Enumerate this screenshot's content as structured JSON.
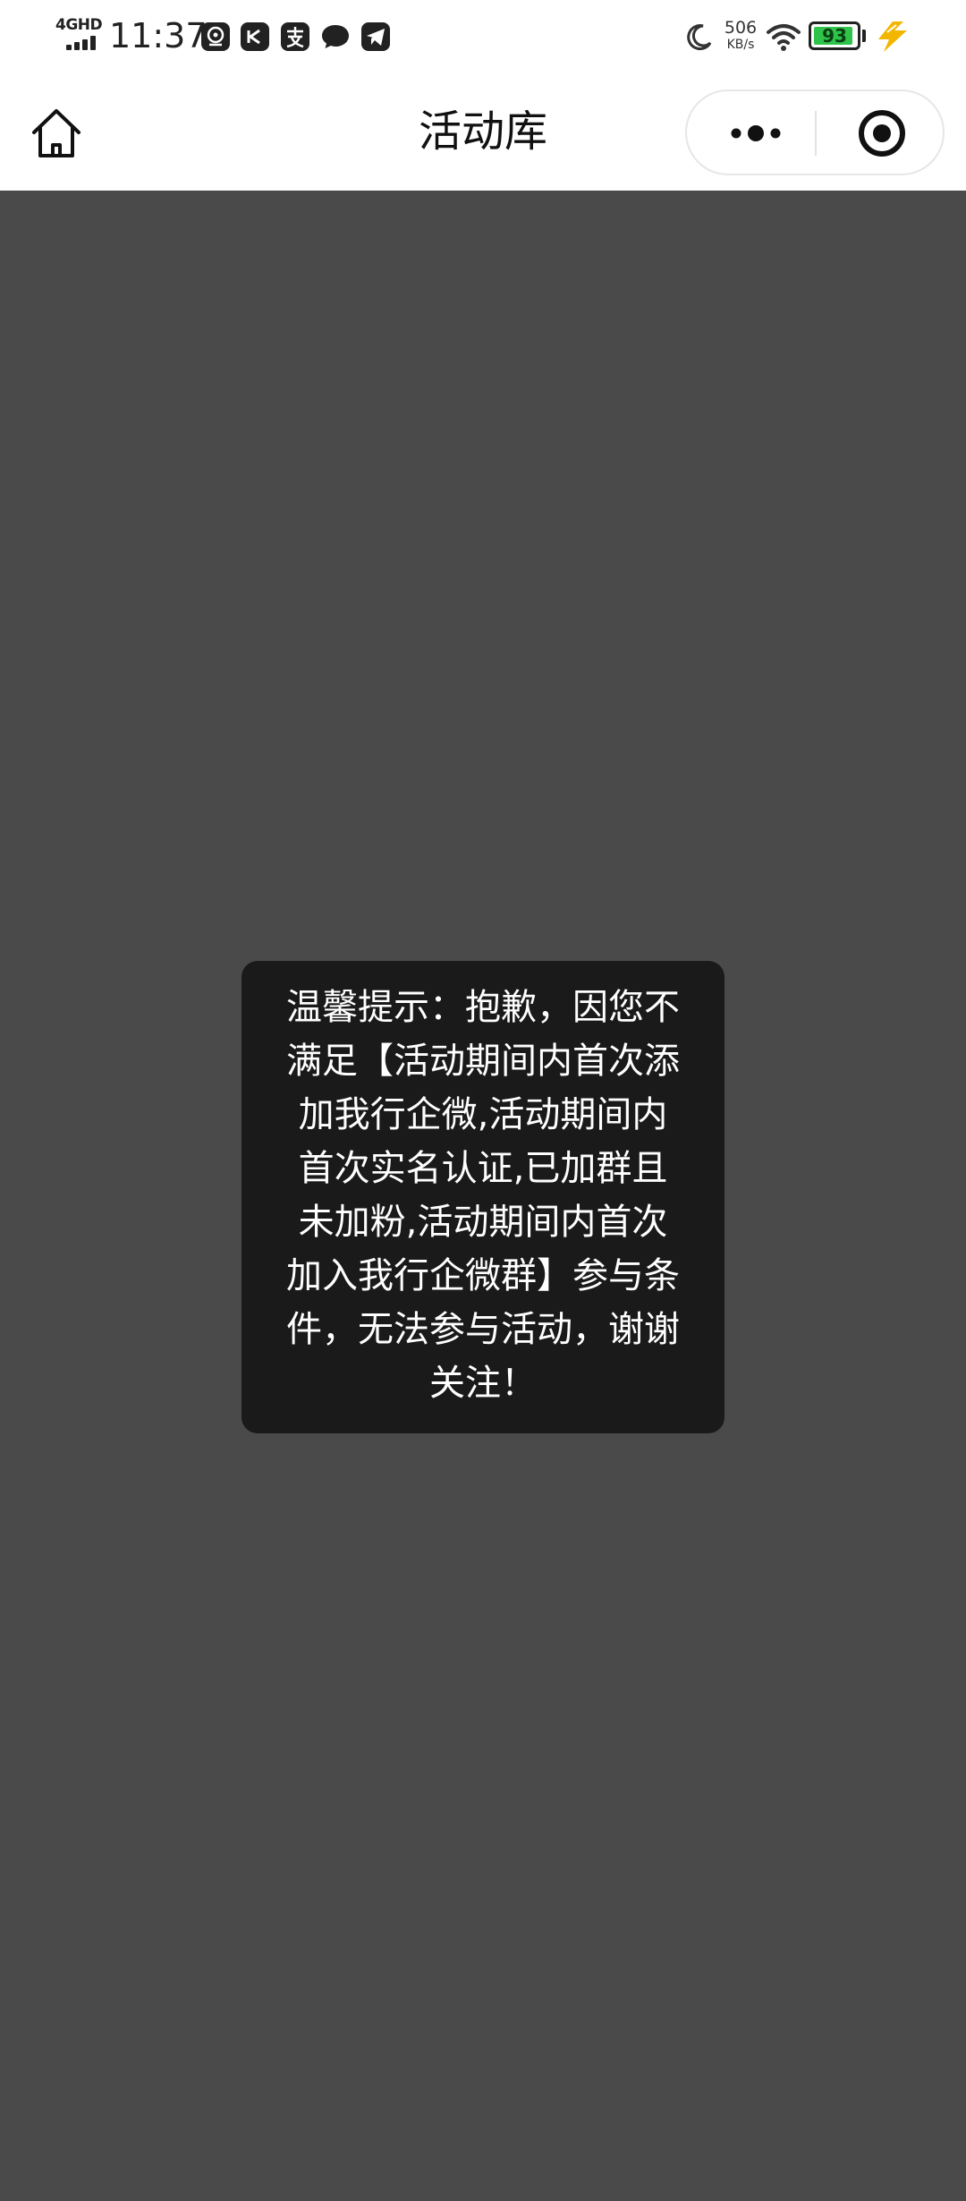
{
  "status_bar": {
    "network_type": "4GHD",
    "time": "11:37",
    "notification_icons": [
      "baidu-map-icon",
      "capcut-icon",
      "alipay-icon",
      "message-icon",
      "telegram-icon"
    ],
    "dnd_icon": "moon-icon",
    "net_speed_value": "506",
    "net_speed_unit": "KB/s",
    "wifi_icon": "wifi-icon",
    "battery_level": "93",
    "battery_fraction": 0.93,
    "charging_icon": "lightning-icon",
    "battery_color": "#2ec44a",
    "charge_color": "#f3b600"
  },
  "nav": {
    "home_icon": "home-icon",
    "title": "活动库",
    "more_icon": "more-dots-icon",
    "close_icon": "close-target-icon"
  },
  "toast": {
    "lines": [
      "温馨提示：抱歉，因您不",
      "满足【活动期间内首次添",
      "加我行企微,活动期间内",
      "首次实名认证,已加群且",
      "未加粉,活动期间内首次",
      "加入我行企微群】参与条",
      "件，无法参与活动，谢谢",
      "关注！"
    ]
  },
  "colors": {
    "overlay_background": "#4a4a4a",
    "toast_background": "#1a1a1a"
  }
}
